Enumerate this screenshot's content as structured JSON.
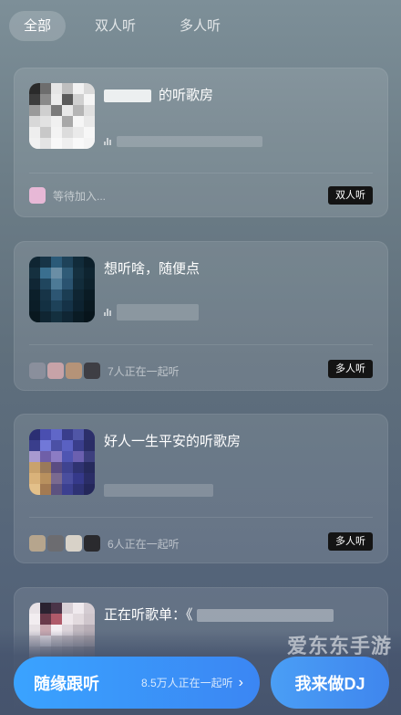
{
  "tabs": [
    {
      "label": "全部",
      "active": true
    },
    {
      "label": "双人听",
      "active": false
    },
    {
      "label": "多人听",
      "active": false
    }
  ],
  "rooms": [
    {
      "title": "的听歌房",
      "member_text": "等待加入...",
      "badge": "双人听",
      "cover_color": "#cfd3d6"
    },
    {
      "title": "想听啥，随便点",
      "member_text": "7人正在一起听",
      "badge": "多人听",
      "cover_color": "#1d3a4c"
    },
    {
      "title": "好人一生平安的听歌房",
      "member_text": "6人正在一起听",
      "badge": "多人听",
      "cover_color": "#3b3f8c"
    },
    {
      "title": "正在听歌单：《",
      "member_text": "",
      "badge": "",
      "cover_color": "#c9c2c8"
    }
  ],
  "bottom": {
    "follow_label": "随缘跟听",
    "follow_sub": "8.5万人正在一起听",
    "follow_chevron": "›",
    "dj_label": "我来做DJ"
  },
  "watermark": "爱东东手游",
  "colors": {
    "accent": "#3b8ff5",
    "badge_bg": "#141414"
  }
}
